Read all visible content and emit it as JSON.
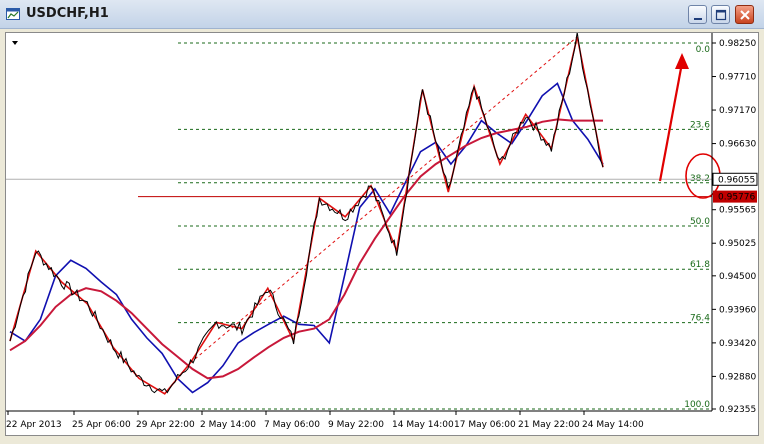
{
  "window": {
    "title": "USDCHF,H1"
  },
  "chart_data": {
    "type": "line",
    "title": "USDCHF,H1",
    "price_axis": [
      "0.98250",
      "0.97710",
      "0.97170",
      "0.96630",
      "0.96055",
      "0.95565",
      "0.95025",
      "0.94500",
      "0.93960",
      "0.93420",
      "0.92880",
      "0.92355"
    ],
    "current_price": "0.96055",
    "red_line_price": "0.95776",
    "time_axis": [
      "22 Apr 2013",
      "25 Apr 06:00",
      "29 Apr 22:00",
      "2 May 14:00",
      "7 May 06:00",
      "9 May 22:00",
      "14 May 14:00",
      "17 May 06:00",
      "21 May 22:00",
      "24 May 14:00"
    ],
    "fibonacci_levels": [
      "0.0",
      "23.6",
      "38.2",
      "50.0",
      "61.8",
      "76.4",
      "100.0"
    ],
    "series": [
      {
        "values": [
          0.936,
          0.9345,
          0.938,
          0.945,
          0.9475,
          0.9462,
          0.944,
          0.942,
          0.938,
          0.935,
          0.9325,
          0.9285,
          0.9262,
          0.9278,
          0.9305,
          0.9342,
          0.9358,
          0.9372,
          0.9385,
          0.9372,
          0.937,
          0.9342,
          0.945,
          0.956,
          0.959,
          0.955,
          0.96,
          0.965,
          0.9665,
          0.963,
          0.966,
          0.97,
          0.968,
          0.9663,
          0.97,
          0.974,
          0.976,
          0.97,
          0.967,
          0.963
        ]
      },
      {
        "values": [
          0.933,
          0.9345,
          0.937,
          0.94,
          0.942,
          0.943,
          0.9425,
          0.941,
          0.939,
          0.9365,
          0.934,
          0.932,
          0.93,
          0.9285,
          0.9288,
          0.93,
          0.9318,
          0.9335,
          0.935,
          0.936,
          0.9365,
          0.938,
          0.942,
          0.947,
          0.951,
          0.9545,
          0.958,
          0.961,
          0.963,
          0.9645,
          0.966,
          0.9672,
          0.968,
          0.9685,
          0.969,
          0.9698,
          0.9702,
          0.97,
          0.97,
          0.97
        ]
      }
    ],
    "zigzag": [
      0.9345,
      0.949,
      0.944,
      0.9405,
      0.9335,
      0.9285,
      0.926,
      0.931,
      0.9375,
      0.9365,
      0.943,
      0.9345,
      0.9575,
      0.9545,
      0.9595,
      0.949,
      0.975,
      0.9585,
      0.9755,
      0.963,
      0.971,
      0.9655,
      0.9835,
      0.9625
    ],
    "annotations": [
      "red upward arrow",
      "red circle around 38.2 level"
    ]
  }
}
